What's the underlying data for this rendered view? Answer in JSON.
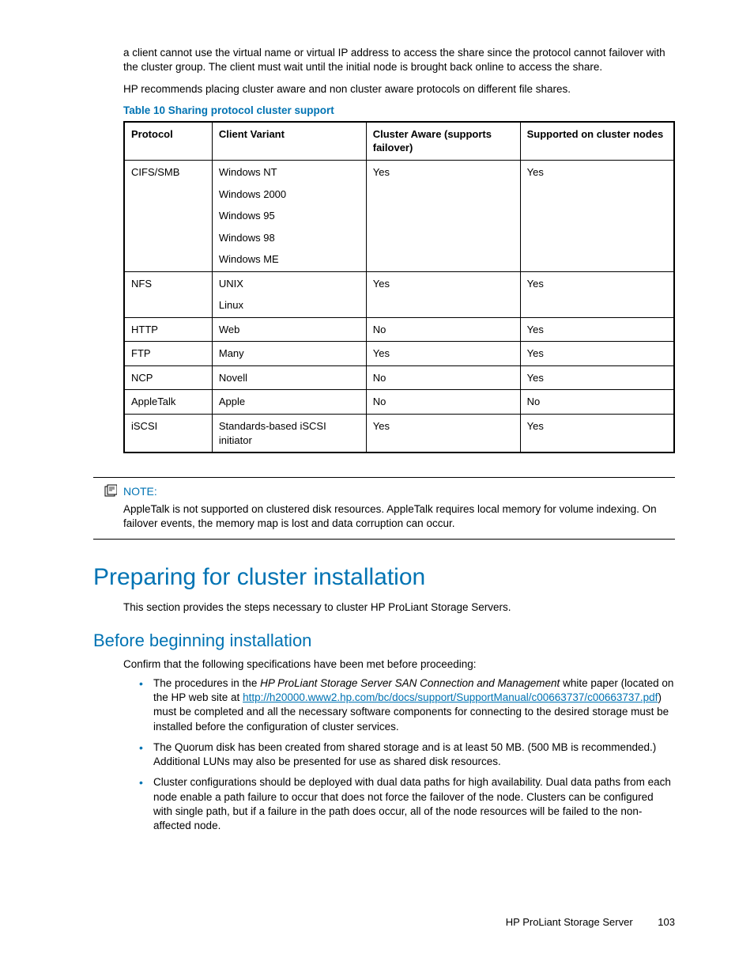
{
  "intro": {
    "p1": "a client cannot use the virtual name or virtual IP address to access the share since the protocol cannot failover with the cluster group. The client must wait until the initial node is brought back online to access the share.",
    "p2": "HP recommends placing cluster aware and non cluster aware protocols on different file shares."
  },
  "table": {
    "caption": "Table 10 Sharing protocol cluster support",
    "headers": {
      "protocol": "Protocol",
      "variant": "Client Variant",
      "aware": "Cluster Aware (supports failover)",
      "supported": "Supported on cluster nodes"
    },
    "rows": [
      {
        "protocol": "CIFS/SMB",
        "variants": [
          "Windows NT",
          "Windows 2000",
          "Windows 95",
          "Windows 98",
          "Windows ME"
        ],
        "aware": "Yes",
        "supported": "Yes"
      },
      {
        "protocol": "NFS",
        "variants": [
          "UNIX",
          "Linux"
        ],
        "aware": "Yes",
        "supported": "Yes"
      },
      {
        "protocol": "HTTP",
        "variants": [
          "Web"
        ],
        "aware": "No",
        "supported": "Yes"
      },
      {
        "protocol": "FTP",
        "variants": [
          "Many"
        ],
        "aware": "Yes",
        "supported": "Yes"
      },
      {
        "protocol": "NCP",
        "variants": [
          "Novell"
        ],
        "aware": "No",
        "supported": "Yes"
      },
      {
        "protocol": "AppleTalk",
        "variants": [
          "Apple"
        ],
        "aware": "No",
        "supported": "No"
      },
      {
        "protocol": "iSCSI",
        "variants": [
          "Standards-based iSCSI initiator"
        ],
        "aware": "Yes",
        "supported": "Yes"
      }
    ]
  },
  "note": {
    "label": "NOTE:",
    "body": "AppleTalk is not supported on clustered disk resources. AppleTalk requires local memory for volume indexing. On failover events, the memory map is lost and data corruption can occur."
  },
  "section1": {
    "heading": "Preparing for cluster installation",
    "body": "This section provides the steps necessary to cluster HP ProLiant Storage Servers."
  },
  "section2": {
    "heading": "Before beginning installation",
    "intro": "Confirm that the following specifications have been met before proceeding:",
    "bullets": {
      "b1": {
        "pre": "The procedures in the ",
        "italic": "HP ProLiant Storage Server SAN Connection and Management",
        "mid": " white paper (located on the HP web site at ",
        "link": "http://h20000.www2.hp.com/bc/docs/support/SupportManual/c00663737/c00663737.pdf",
        "post": ") must be completed and all the necessary software components for connecting to the desired storage must be installed before the configuration of cluster services."
      },
      "b2": "The Quorum disk has been created from shared storage and is at least 50 MB. (500 MB is recommended.) Additional LUNs may also be presented for use as shared disk resources.",
      "b3": "Cluster configurations should be deployed with dual data paths for high availability. Dual data paths from each node enable a path failure to occur that does not force the failover of the node. Clusters can be configured with single path, but if a failure in the path does occur, all of the node resources will be failed to the non-affected node."
    }
  },
  "footer": {
    "title": "HP ProLiant Storage Server",
    "page": "103"
  }
}
